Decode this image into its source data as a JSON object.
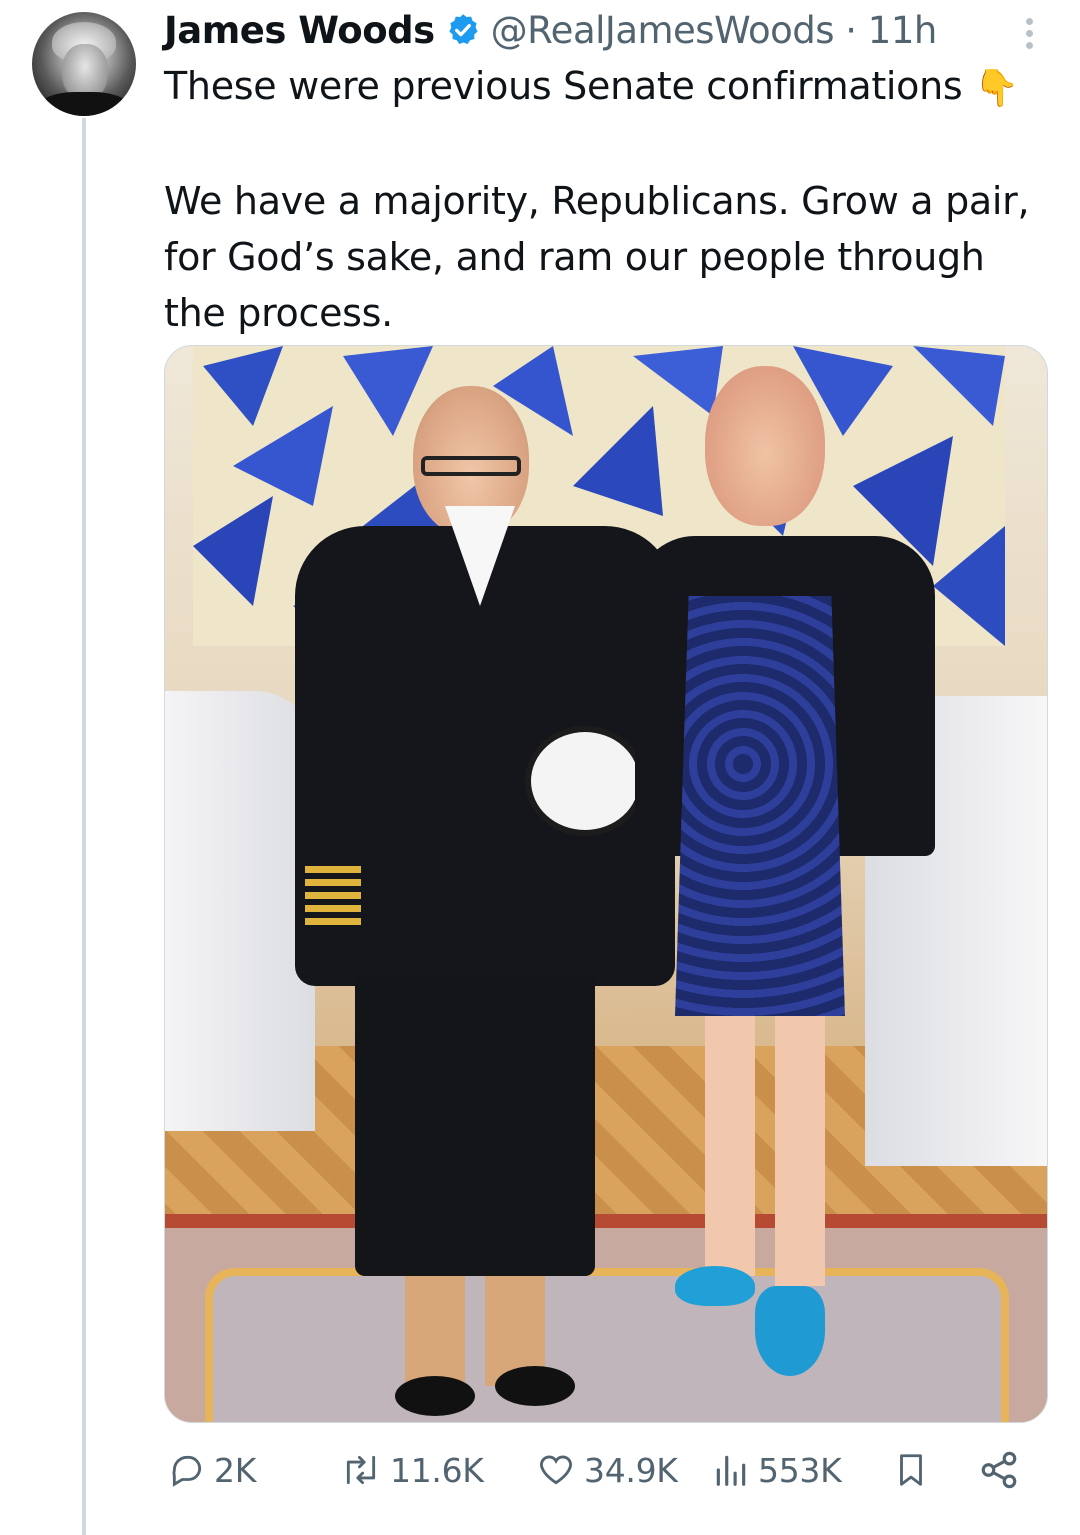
{
  "tweet": {
    "author_name": "James Woods",
    "handle_time": "@RealJamesWoods · 11h",
    "line1": "These were previous Senate confirmations",
    "line1_emoji": "👇",
    "paragraph2_line1": "We have a majority, Republicans. Grow a pair,",
    "paragraph2_line2": "for God’s sake, and ram our people through",
    "paragraph2_line3": "the process."
  },
  "actions": {
    "replies": "2K",
    "reposts": "11.6K",
    "likes": "34.9K",
    "views": "553K"
  },
  "icons": {
    "verified": "verified-badge-icon",
    "more": "more-options-icon",
    "reply": "reply-icon",
    "repost": "repost-icon",
    "like": "heart-icon",
    "views": "views-bar-chart-icon",
    "bookmark": "bookmark-icon",
    "share": "share-icon"
  },
  "colors": {
    "verified_blue": "#1d9bf0",
    "muted_text": "#536471"
  }
}
